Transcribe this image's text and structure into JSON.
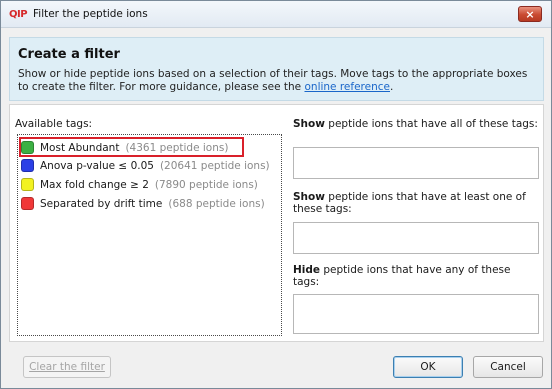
{
  "window": {
    "icon_text": "QIP",
    "title": "Filter the peptide ions",
    "close_symbol": "×"
  },
  "header": {
    "title": "Create a filter",
    "description_prefix": "Show or hide peptide ions based on a selection of their tags. Move tags to the appropriate boxes to create the filter. For more guidance, please see the ",
    "link_text": "online reference",
    "description_suffix": "."
  },
  "available": {
    "label": "Available tags:",
    "tags": [
      {
        "name": "Most Abundant",
        "count": "(4361 peptide ions)",
        "color": "#3cb043"
      },
      {
        "name": "Anova p-value ≤ 0.05",
        "count": "(20641 peptide ions)",
        "color": "#2b3fe6"
      },
      {
        "name": "Max fold change ≥ 2",
        "count": "(7890 peptide ions)",
        "color": "#f2f220"
      },
      {
        "name": "Separated by drift time",
        "count": "(688 peptide ions)",
        "color": "#f03838"
      }
    ]
  },
  "targets": {
    "all": {
      "verb": "Show",
      "rest": " peptide ions that have all of these tags:"
    },
    "any_one": {
      "verb": "Show",
      "rest": " peptide ions that have at least one of these tags:"
    },
    "hide": {
      "verb": "Hide",
      "rest": " peptide ions that have any of these tags:"
    }
  },
  "footer": {
    "clear_label": "Clear the filter",
    "ok_label": "OK",
    "cancel_label": "Cancel"
  },
  "colors": {
    "header_bg": "#deeef6",
    "highlight_border": "#d9202a",
    "link": "#1a66c9"
  }
}
